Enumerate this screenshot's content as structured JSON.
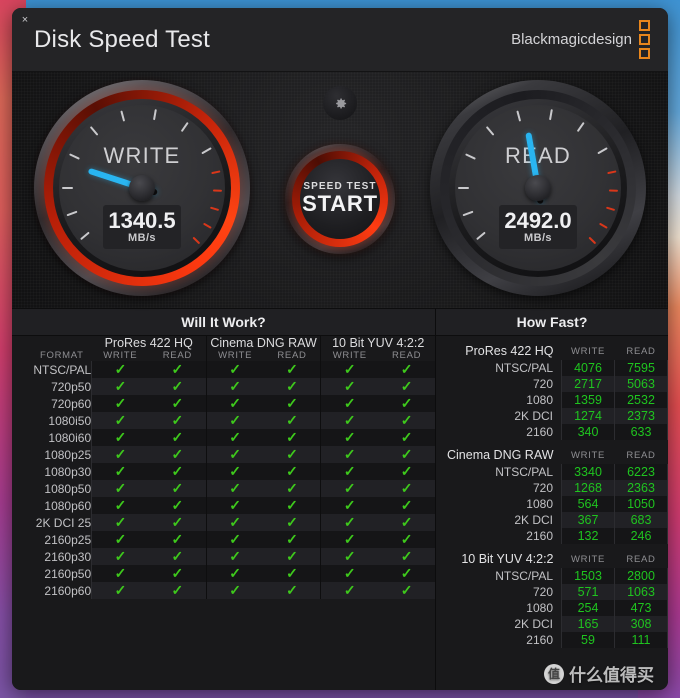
{
  "window": {
    "close_label": "×",
    "title": "Disk Speed Test",
    "brand": "Blackmagicdesign"
  },
  "gauges": {
    "write": {
      "label": "WRITE",
      "value": "1340.5",
      "unit": "MB/s",
      "needle_deg": -72
    },
    "read": {
      "label": "READ",
      "value": "2492.0",
      "unit": "MB/s",
      "needle_deg": -10
    },
    "center": {
      "gear_icon": "gear-icon",
      "button_line1": "SPEED TEST",
      "button_line2": "START"
    }
  },
  "will_it_work": {
    "title": "Will It Work?",
    "format_header": "FORMAT",
    "codecs": [
      "ProRes 422 HQ",
      "Cinema DNG RAW",
      "10 Bit YUV 4:2:2"
    ],
    "sub_headers": [
      "WRITE",
      "READ"
    ],
    "check_glyph": "✓",
    "rows": [
      {
        "format": "NTSC/PAL",
        "cells": [
          true,
          true,
          true,
          true,
          true,
          true
        ]
      },
      {
        "format": "720p50",
        "cells": [
          true,
          true,
          true,
          true,
          true,
          true
        ]
      },
      {
        "format": "720p60",
        "cells": [
          true,
          true,
          true,
          true,
          true,
          true
        ]
      },
      {
        "format": "1080i50",
        "cells": [
          true,
          true,
          true,
          true,
          true,
          true
        ]
      },
      {
        "format": "1080i60",
        "cells": [
          true,
          true,
          true,
          true,
          true,
          true
        ]
      },
      {
        "format": "1080p25",
        "cells": [
          true,
          true,
          true,
          true,
          true,
          true
        ]
      },
      {
        "format": "1080p30",
        "cells": [
          true,
          true,
          true,
          true,
          true,
          true
        ]
      },
      {
        "format": "1080p50",
        "cells": [
          true,
          true,
          true,
          true,
          true,
          true
        ]
      },
      {
        "format": "1080p60",
        "cells": [
          true,
          true,
          true,
          true,
          true,
          true
        ]
      },
      {
        "format": "2K DCI 25",
        "cells": [
          true,
          true,
          true,
          true,
          true,
          true
        ]
      },
      {
        "format": "2160p25",
        "cells": [
          true,
          true,
          true,
          true,
          true,
          true
        ]
      },
      {
        "format": "2160p30",
        "cells": [
          true,
          true,
          true,
          true,
          true,
          true
        ]
      },
      {
        "format": "2160p50",
        "cells": [
          true,
          true,
          true,
          true,
          true,
          true
        ]
      },
      {
        "format": "2160p60",
        "cells": [
          true,
          true,
          true,
          true,
          true,
          true
        ]
      }
    ]
  },
  "how_fast": {
    "title": "How Fast?",
    "sub_headers": [
      "WRITE",
      "READ"
    ],
    "sections": [
      {
        "name": "ProRes 422 HQ",
        "rows": [
          {
            "res": "NTSC/PAL",
            "write": "4076",
            "read": "7595"
          },
          {
            "res": "720",
            "write": "2717",
            "read": "5063"
          },
          {
            "res": "1080",
            "write": "1359",
            "read": "2532"
          },
          {
            "res": "2K DCI",
            "write": "1274",
            "read": "2373"
          },
          {
            "res": "2160",
            "write": "340",
            "read": "633"
          }
        ]
      },
      {
        "name": "Cinema DNG RAW",
        "rows": [
          {
            "res": "NTSC/PAL",
            "write": "3340",
            "read": "6223"
          },
          {
            "res": "720",
            "write": "1268",
            "read": "2363"
          },
          {
            "res": "1080",
            "write": "564",
            "read": "1050"
          },
          {
            "res": "2K DCI",
            "write": "367",
            "read": "683"
          },
          {
            "res": "2160",
            "write": "132",
            "read": "246"
          }
        ]
      },
      {
        "name": "10 Bit YUV 4:2:2",
        "rows": [
          {
            "res": "NTSC/PAL",
            "write": "1503",
            "read": "2800"
          },
          {
            "res": "720",
            "write": "571",
            "read": "1063"
          },
          {
            "res": "1080",
            "write": "254",
            "read": "473"
          },
          {
            "res": "2K DCI",
            "write": "165",
            "read": "308"
          },
          {
            "res": "2160",
            "write": "59",
            "read": "111"
          }
        ]
      }
    ]
  },
  "watermark": {
    "badge": "值",
    "text": "什么值得买"
  },
  "colors": {
    "accent_red": "#ff3c12",
    "needle_blue": "#28b4f0",
    "check_green": "#3ec91c",
    "value_green": "#1fc41f",
    "brand_orange": "#e8861c"
  }
}
